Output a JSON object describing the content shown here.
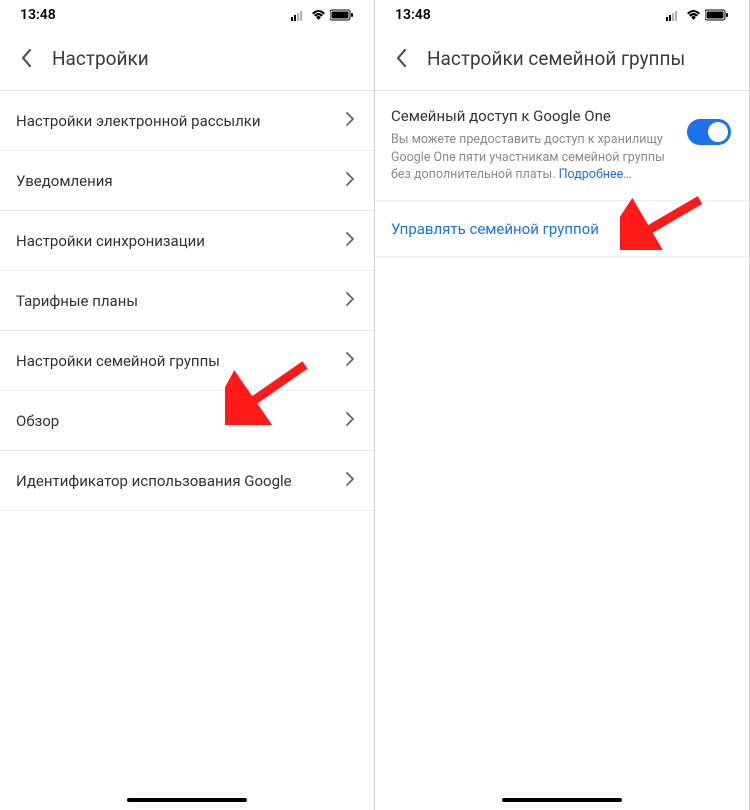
{
  "status": {
    "time": "13:48"
  },
  "left": {
    "header": {
      "title": "Настройки"
    },
    "items": [
      {
        "label": "Настройки электронной рассылки"
      },
      {
        "label": "Уведомления"
      },
      {
        "label": "Настройки синхронизации"
      },
      {
        "label": "Тарифные планы"
      },
      {
        "label": "Настройки семейной группы"
      },
      {
        "label": "Обзор"
      },
      {
        "label": "Идентификатор использования Google"
      }
    ]
  },
  "right": {
    "header": {
      "title": "Настройки семейной группы"
    },
    "section": {
      "title": "Семейный доступ к Google One",
      "desc": "Вы можете предоставить доступ к хранилищу Google One пяти участникам семейной группы без дополнительной платы. ",
      "learn_more": "Подробнее…"
    },
    "link": {
      "label": "Управлять семейной группой"
    }
  }
}
